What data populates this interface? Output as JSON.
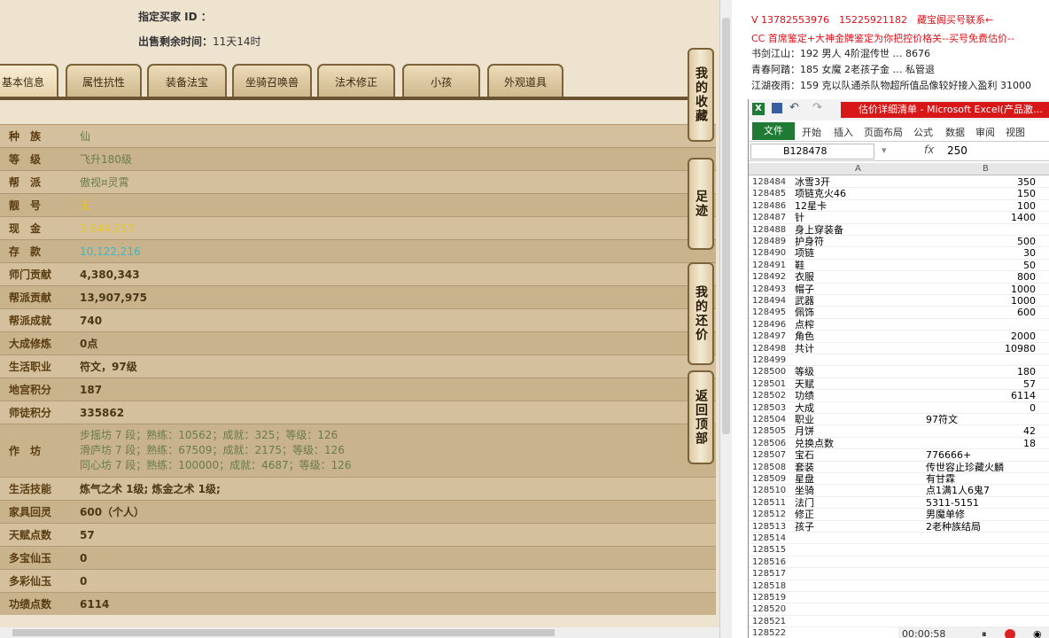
{
  "header": {
    "buyer_label": "指定买家 ID ：",
    "time_label": "出售剩余时间：",
    "time_value": "11天14时"
  },
  "tabs": [
    "基本信息",
    "属性抗性",
    "装备法宝",
    "坐骑召唤兽",
    "法术修正",
    "小孩",
    "外观道具"
  ],
  "side_buttons": [
    "我的收藏",
    "足迹",
    "我的还价",
    "返回顶部"
  ],
  "info_rows": [
    {
      "label": "种　族",
      "value": "仙",
      "style": "g"
    },
    {
      "label": "等　级",
      "value": "飞升180级",
      "style": "g"
    },
    {
      "label": "帮　派",
      "value": "傲视¤灵霄",
      "style": "g"
    },
    {
      "label": "靓　号",
      "value": "无",
      "style": "y"
    },
    {
      "label": "现　金",
      "value": "3,644,757",
      "style": "y"
    },
    {
      "label": "存　款",
      "value": "10,122,216",
      "style": "c"
    },
    {
      "label": "师门贡献",
      "value": "4,380,343",
      "style": "b"
    },
    {
      "label": "帮派贡献",
      "value": "13,907,975",
      "style": "b"
    },
    {
      "label": "帮派成就",
      "value": "740",
      "style": "b"
    },
    {
      "label": "大成修炼",
      "value": "0点",
      "style": "b"
    },
    {
      "label": "生活职业",
      "value": "符文，97级",
      "style": "b"
    },
    {
      "label": "地宫积分",
      "value": "187",
      "style": "b"
    },
    {
      "label": "师徒积分",
      "value": "335862",
      "style": "b"
    }
  ],
  "workshop": {
    "label": "作　坊",
    "lines": [
      "步摇坊 7 段；熟练：10562；成就：325；等级：126",
      "滑庐坊 7 段；熟练：67509；成就：2175；等级：126",
      "同心坊 7 段；熟练：100000；成就：4687；等级：126"
    ]
  },
  "info_rows2": [
    {
      "label": "生活技能",
      "value": "炼气之术 1级; 炼金之术 1级;"
    },
    {
      "label": "家具回灵",
      "value": "600（个人）"
    },
    {
      "label": "天赋点数",
      "value": "57"
    },
    {
      "label": "多宝仙玉",
      "value": "0"
    },
    {
      "label": "多彩仙玉",
      "value": "0"
    },
    {
      "label": "功绩点数",
      "value": "6114"
    }
  ],
  "annotations": [
    {
      "text": "V 13782553976　15225921182　藏宝阁买号联系←",
      "color": "#e0101a"
    },
    {
      "text": "CC 首席鉴定+大神金牌鉴定为你把控价格关--买号免费估价--",
      "color": "#e0101a"
    },
    {
      "text": "书剑江山：192 男人 4阶混传世 … 8676",
      "color": "#222"
    },
    {
      "text": "青春阿踏：185 女魔 2老孩子金 … 私管退",
      "color": "#222"
    },
    {
      "text": "江湖夜雨：159 克以队通杀队物超所值品像较好接入盈利 31000",
      "color": "#222"
    }
  ],
  "excel": {
    "doc_title": "估价详细清单 - Microsoft Excel(产品激…",
    "ribbon": [
      "开始",
      "插入",
      "页面布局",
      "公式",
      "数据",
      "审阅",
      "视图"
    ],
    "file_tab": "文件",
    "name_box": "B128478",
    "formula": "250",
    "col_a": "A",
    "col_b": "B",
    "rows": [
      {
        "n": "128484",
        "a": "冰雪3开",
        "b": "350"
      },
      {
        "n": "128485",
        "a": "项链克火46",
        "b": "150"
      },
      {
        "n": "128486",
        "a": "12星卡",
        "b": "100"
      },
      {
        "n": "128487",
        "a": "针",
        "b": "1400"
      },
      {
        "n": "128488",
        "a": "身上穿装备",
        "b": ""
      },
      {
        "n": "128489",
        "a": "护身符",
        "b": "500"
      },
      {
        "n": "128490",
        "a": "项链",
        "b": "30"
      },
      {
        "n": "128491",
        "a": "鞋",
        "b": "50"
      },
      {
        "n": "128492",
        "a": "衣服",
        "b": "800"
      },
      {
        "n": "128493",
        "a": "帽子",
        "b": "1000"
      },
      {
        "n": "128494",
        "a": "武器",
        "b": "1000"
      },
      {
        "n": "128495",
        "a": "佩饰",
        "b": "600"
      },
      {
        "n": "128496",
        "a": "点榨",
        "b": ""
      },
      {
        "n": "128497",
        "a": "角色",
        "b": "2000"
      },
      {
        "n": "128498",
        "a": "共计",
        "b": "10980"
      },
      {
        "n": "128499",
        "a": "",
        "b": ""
      },
      {
        "n": "128500",
        "a": "等级",
        "b": "180"
      },
      {
        "n": "128501",
        "a": "天赋",
        "b": "57"
      },
      {
        "n": "128502",
        "a": "功绩",
        "b": "6114"
      },
      {
        "n": "128503",
        "a": "大成",
        "b": "0"
      },
      {
        "n": "128504",
        "a": "职业",
        "t": "97符文"
      },
      {
        "n": "128505",
        "a": "月饼",
        "b": "42"
      },
      {
        "n": "128506",
        "a": "兑换点数",
        "b": "18"
      },
      {
        "n": "128507",
        "a": "宝石",
        "t": "776666+"
      },
      {
        "n": "128508",
        "a": "套装",
        "t": "传世容止珍藏火麟"
      },
      {
        "n": "128509",
        "a": "星盘",
        "t": "有甘霖"
      },
      {
        "n": "128510",
        "a": "坐骑",
        "t": "点1满1人6鬼7"
      },
      {
        "n": "128511",
        "a": "法门",
        "t": "5311-5151"
      },
      {
        "n": "128512",
        "a": "修正",
        "t": "男魔单修"
      },
      {
        "n": "128513",
        "a": "孩子",
        "t": "2老种族结局"
      },
      {
        "n": "128514",
        "a": "",
        "b": ""
      },
      {
        "n": "128515",
        "a": "",
        "b": ""
      },
      {
        "n": "128516",
        "a": "",
        "b": ""
      },
      {
        "n": "128517",
        "a": "",
        "b": ""
      },
      {
        "n": "128518",
        "a": "",
        "b": ""
      },
      {
        "n": "128519",
        "a": "",
        "b": ""
      },
      {
        "n": "128520",
        "a": "",
        "b": ""
      },
      {
        "n": "128521",
        "a": "",
        "b": ""
      },
      {
        "n": "128522",
        "a": "",
        "b": ""
      }
    ]
  },
  "recorder": {
    "time": "00:00:58"
  }
}
